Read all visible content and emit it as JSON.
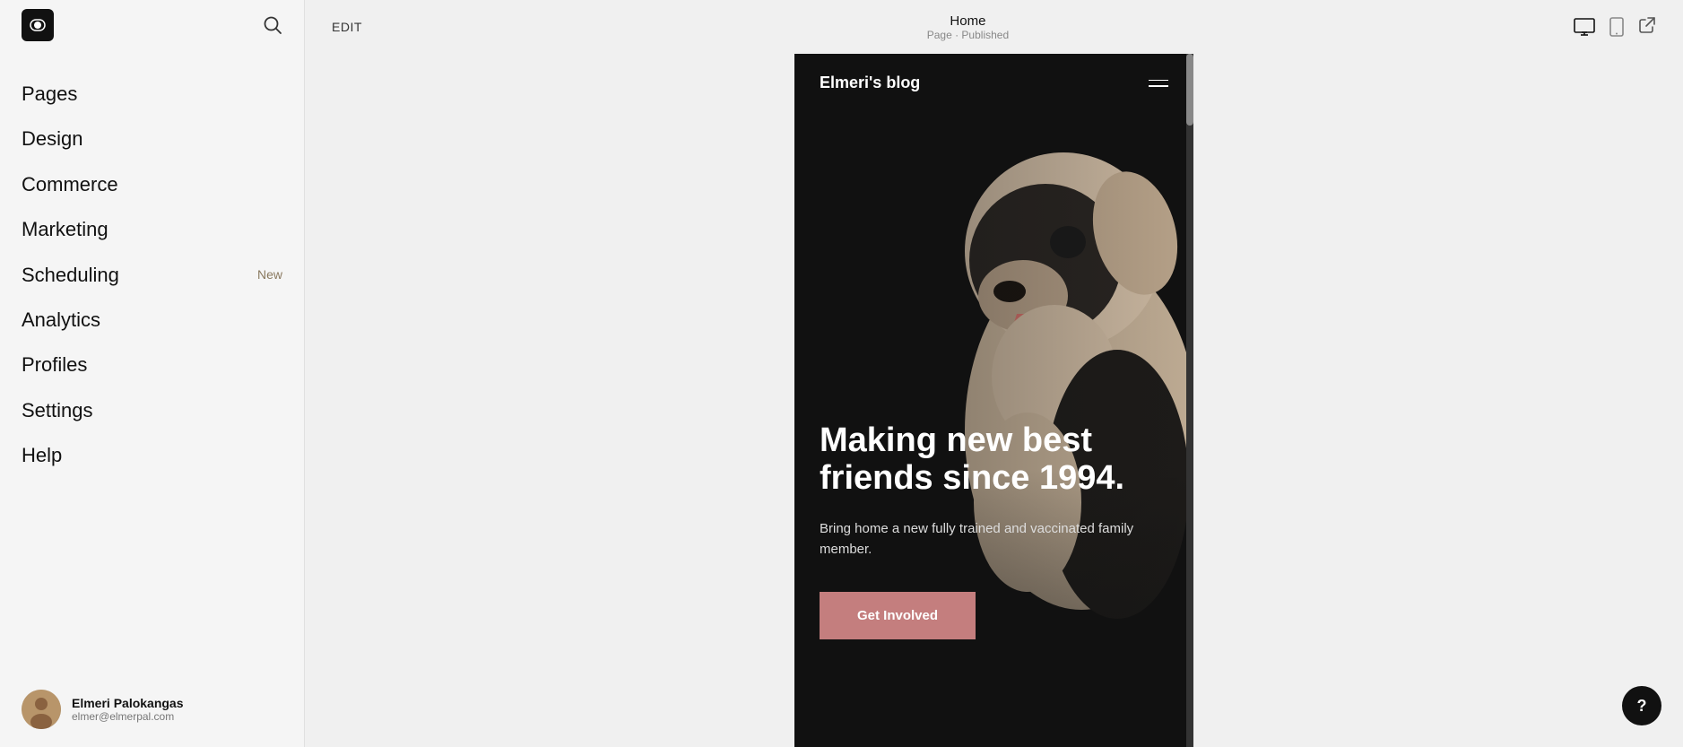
{
  "sidebar": {
    "logo_alt": "Squarespace logo",
    "search_label": "Search",
    "nav_items": [
      {
        "id": "pages",
        "label": "Pages",
        "badge": null
      },
      {
        "id": "design",
        "label": "Design",
        "badge": null
      },
      {
        "id": "commerce",
        "label": "Commerce",
        "badge": null
      },
      {
        "id": "marketing",
        "label": "Marketing",
        "badge": null
      },
      {
        "id": "scheduling",
        "label": "Scheduling",
        "badge": "New"
      },
      {
        "id": "analytics",
        "label": "Analytics",
        "badge": null
      },
      {
        "id": "profiles",
        "label": "Profiles",
        "badge": null
      },
      {
        "id": "settings",
        "label": "Settings",
        "badge": null
      },
      {
        "id": "help",
        "label": "Help",
        "badge": null
      }
    ],
    "user": {
      "name": "Elmeri Palokangas",
      "email": "elmer@elmerpal.com"
    }
  },
  "topbar": {
    "edit_label": "EDIT",
    "page_title": "Home",
    "page_subtitle": "Page · Published",
    "device_desktop_label": "Desktop view",
    "device_mobile_label": "Mobile view",
    "external_label": "Open in new tab"
  },
  "preview": {
    "site_title": "Elmeri's blog",
    "hero_title": "Making new best friends since 1994.",
    "hero_subtitle": "Bring home a new fully trained and vaccinated family member.",
    "cta_label": "Get Involved"
  },
  "help_button": {
    "label": "?"
  },
  "colors": {
    "accent": "#c47e7e",
    "sidebar_bg": "#f5f5f5",
    "canvas_bg": "#f0f0f0",
    "preview_bg": "#111111",
    "badge_color": "#8a7a60"
  }
}
